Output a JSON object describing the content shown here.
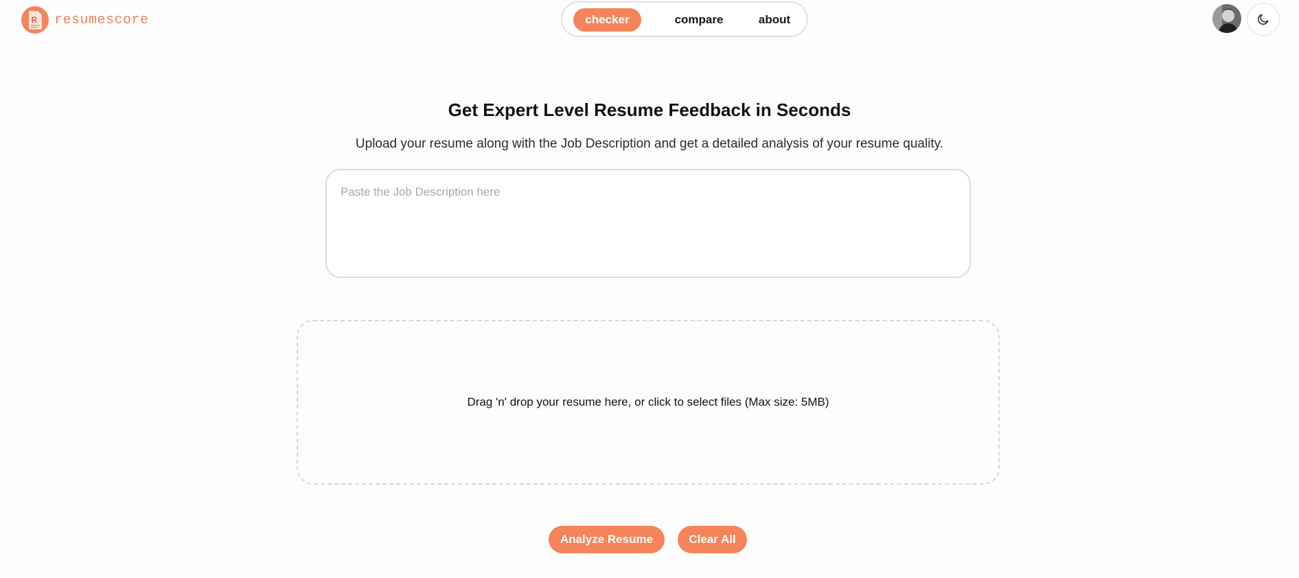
{
  "brand": {
    "name": "resumescore",
    "logo_letter": "R",
    "logo_icon": "resume-document-icon"
  },
  "nav": {
    "tabs": [
      {
        "label": "checker",
        "active": true
      },
      {
        "label": "compare",
        "active": false
      },
      {
        "label": "about",
        "active": false
      }
    ]
  },
  "header": {
    "avatar_icon": "user-avatar",
    "theme_toggle_icon": "moon-icon"
  },
  "main": {
    "title": "Get Expert Level Resume Feedback in Seconds",
    "subtitle": "Upload your resume along with the Job Description and get a detailed analysis of your resume quality.",
    "job_description": {
      "placeholder": "Paste the Job Description here",
      "value": ""
    },
    "dropzone_text": "Drag 'n' drop your resume here, or click to select files (Max size: 5MB)",
    "buttons": {
      "analyze": "Analyze Resume",
      "clear": "Clear All"
    }
  },
  "colors": {
    "accent": "#f5845a",
    "brand_text": "#f0845d",
    "border": "#dcdcdc"
  }
}
